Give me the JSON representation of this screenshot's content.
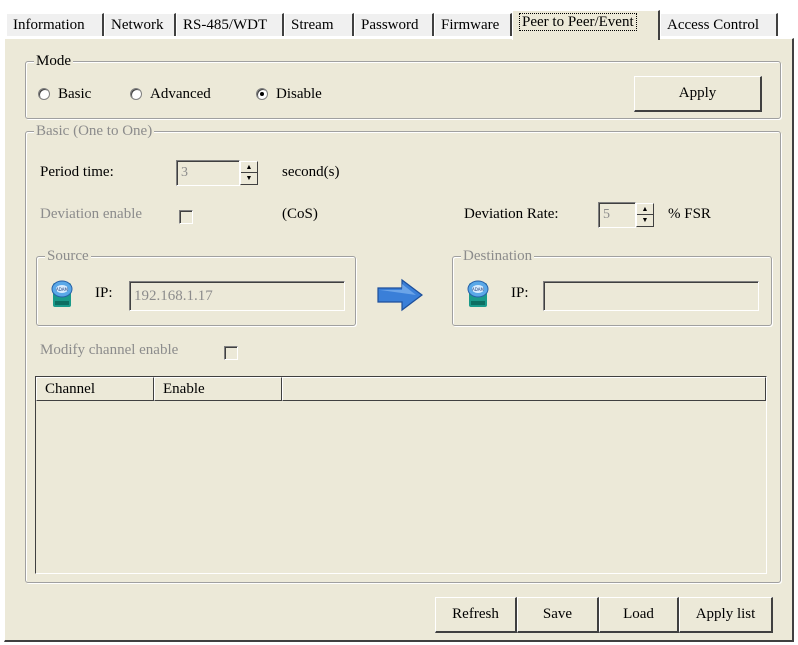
{
  "tabs": [
    {
      "label": "Information"
    },
    {
      "label": "Network"
    },
    {
      "label": "RS-485/WDT"
    },
    {
      "label": "Stream"
    },
    {
      "label": "Password"
    },
    {
      "label": "Firmware"
    },
    {
      "label": "Peer to Peer/Event",
      "active": true
    },
    {
      "label": "Access Control"
    }
  ],
  "mode": {
    "title": "Mode",
    "options": [
      {
        "label": "Basic",
        "selected": false
      },
      {
        "label": "Advanced",
        "selected": false
      },
      {
        "label": "Disable",
        "selected": true
      }
    ],
    "apply_label": "Apply"
  },
  "basic": {
    "title": "Basic (One to One)",
    "period_label": "Period time:",
    "period_value": "3",
    "period_unit": "second(s)",
    "deviation_enable_label": "Deviation enable",
    "deviation_enable_checked": false,
    "cos_label": "(CoS)",
    "deviation_rate_label": "Deviation Rate:",
    "deviation_rate_value": "5",
    "deviation_rate_unit": "% FSR",
    "source": {
      "title": "Source",
      "ip_label": "IP:",
      "ip_value": "192.168.1.17"
    },
    "destination": {
      "title": "Destination",
      "ip_label": "IP:",
      "ip_value": ""
    },
    "modify_channel_label": "Modify channel enable",
    "modify_channel_checked": false,
    "table": {
      "columns": [
        "Channel",
        "Enable",
        ""
      ],
      "rows": []
    }
  },
  "footer": {
    "refresh_label": "Refresh",
    "save_label": "Save",
    "load_label": "Load",
    "apply_list_label": "Apply list"
  },
  "colors": {
    "panel_bg": "#ece9d8",
    "disabled_text": "#8c8c8c",
    "arrow_blue": "#3a7fd8",
    "device_teal": "#1a9a8a"
  }
}
